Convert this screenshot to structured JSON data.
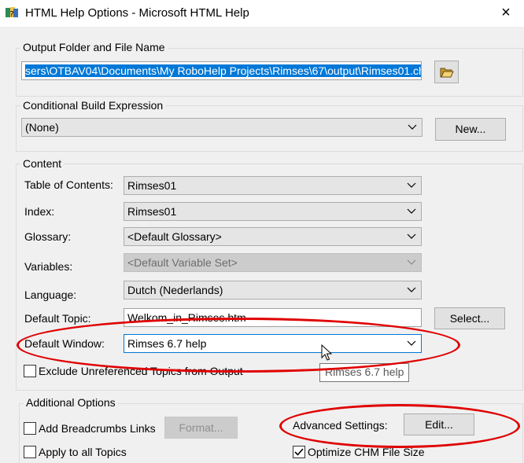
{
  "window": {
    "title": "HTML Help Options - Microsoft HTML Help",
    "close_glyph": "×"
  },
  "output": {
    "group_label": "Output Folder and File Name",
    "path": "sers\\OTBAV04\\Documents\\My RoboHelp Projects\\Rimses\\67\\output\\Rimses01.chm"
  },
  "conditional": {
    "group_label": "Conditional Build Expression",
    "value": "(None)",
    "new_button": "New..."
  },
  "content": {
    "group_label": "Content",
    "toc_label": "Table of Contents:",
    "toc_value": "Rimses01",
    "index_label": "Index:",
    "index_value": "Rimses01",
    "glossary_label": "Glossary:",
    "glossary_value": "<Default Glossary>",
    "variables_label": "Variables:",
    "variables_value": "<Default Variable Set>",
    "language_label": "Language:",
    "language_value": "Dutch (Nederlands)",
    "topic_label": "Default Topic:",
    "topic_value": "Welkom_in_Rimses.htm",
    "select_button": "Select...",
    "window_label": "Default Window:",
    "window_value": "Rimses 6.7 help",
    "exclude_label": "Exclude Unreferenced Topics from Output",
    "tooltip": "Rimses 6.7 help"
  },
  "additional": {
    "group_label": "Additional Options",
    "breadcrumbs_label": "Add Breadcrumbs Links",
    "format_button": "Format...",
    "advanced_label": "Advanced Settings:",
    "edit_button": "Edit...",
    "apply_label": "Apply to all Topics",
    "optimize_label": "Optimize CHM File Size",
    "optimize_checked": true
  },
  "colors": {
    "annotation": "#e00000",
    "selection": "#0078d7"
  }
}
